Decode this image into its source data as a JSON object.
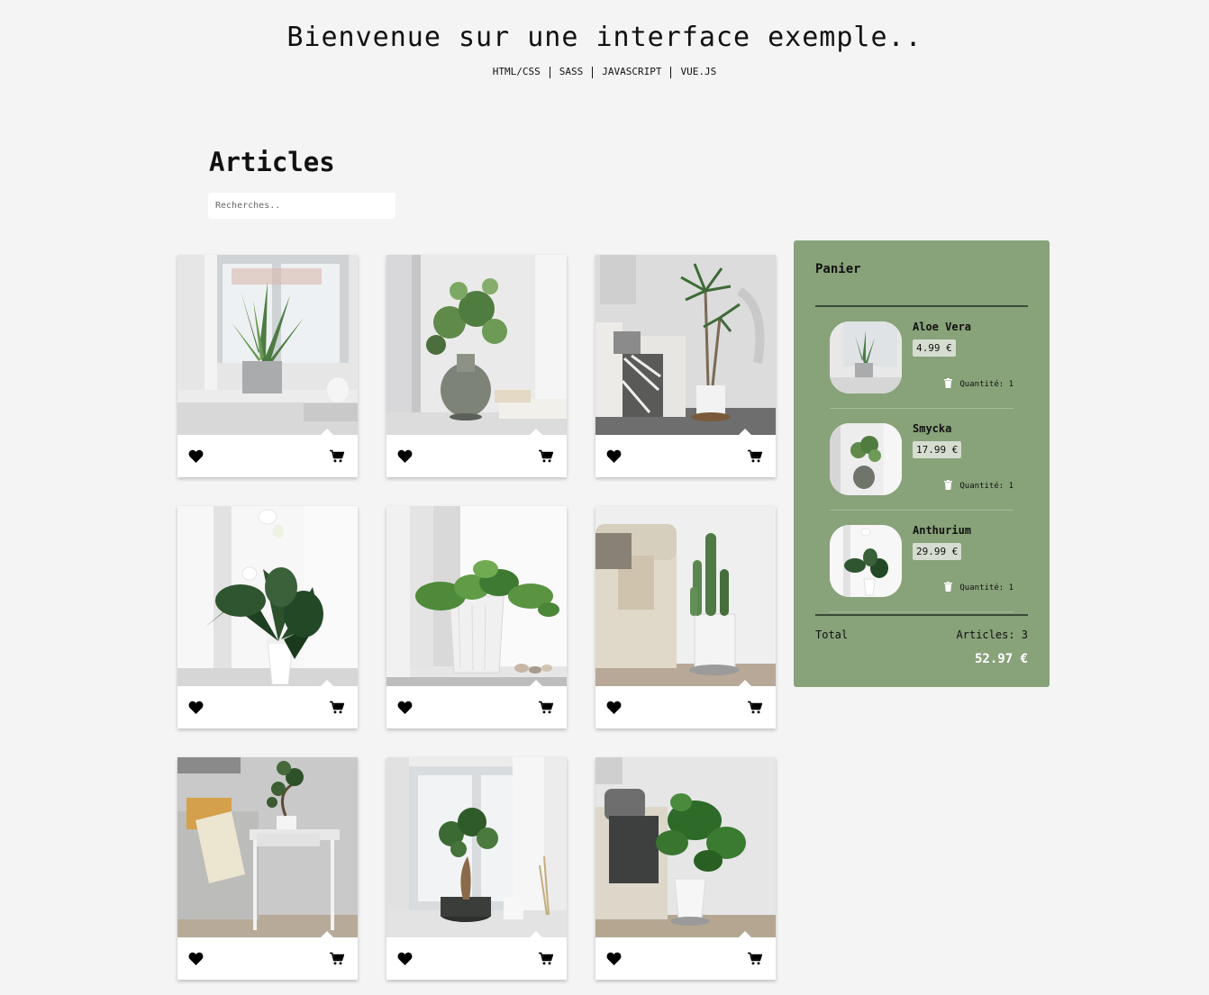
{
  "header": {
    "title": "Bienvenue sur une interface exemple..",
    "tech": [
      "HTML/CSS",
      "SASS",
      "JAVASCRIPT",
      "VUE.JS"
    ]
  },
  "articles": {
    "title": "Articles",
    "search_placeholder": "Recherches.."
  },
  "icons": {
    "favorite": "heart-icon",
    "add_to_cart": "cart-icon",
    "remove": "trash-icon"
  },
  "colors": {
    "cart_bg": "#88a27a",
    "page_bg": "#f4f4f4",
    "accent_dark": "#374a35"
  },
  "cart": {
    "title": "Panier",
    "items": [
      {
        "name": "Aloe Vera",
        "price": "4.99 €",
        "quantity": "Quantité: 1"
      },
      {
        "name": "Smycka",
        "price": "17.99 €",
        "quantity": "Quantité: 1"
      },
      {
        "name": "Anthurium",
        "price": "29.99 €",
        "quantity": "Quantité: 1"
      }
    ],
    "total_label": "Total",
    "count_label": "Articles: 3",
    "total_value": "52.97 €"
  }
}
